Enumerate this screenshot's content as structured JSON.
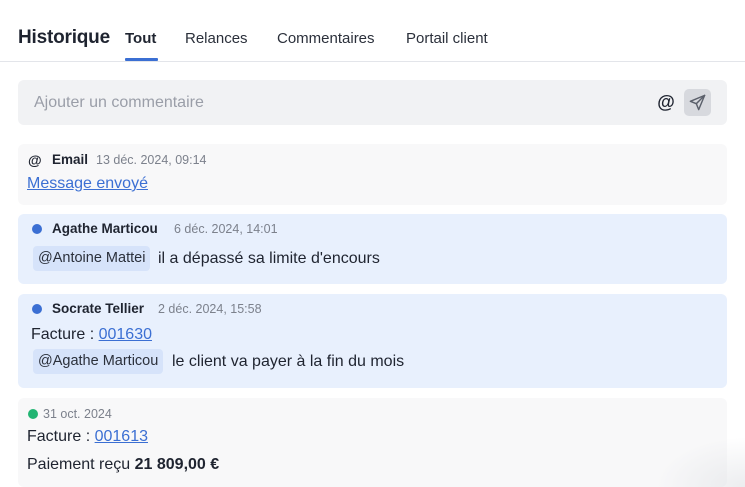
{
  "header": {
    "title": "Historique",
    "tabs": [
      {
        "label": "Tout",
        "active": true
      },
      {
        "label": "Relances",
        "active": false
      },
      {
        "label": "Commentaires",
        "active": false
      },
      {
        "label": "Portail client",
        "active": false
      }
    ]
  },
  "composer": {
    "placeholder": "Ajouter un commentaire",
    "mention_symbol": "@",
    "send_icon": "send-icon"
  },
  "colors": {
    "accent": "#3b6fd3",
    "comment_dot": "#3b6fd3",
    "payment_dot": "#22b573"
  },
  "entries": [
    {
      "type": "email",
      "icon": "@",
      "author": "Email",
      "date": "13 déc. 2024, 09:14",
      "link_text": "Message envoyé"
    },
    {
      "type": "comment",
      "author": "Agathe Marticou",
      "date": "6 déc. 2024, 14:01",
      "mention": "@Antoine Mattei",
      "text": "il a dépassé sa limite d'encours"
    },
    {
      "type": "comment",
      "author": "Socrate Tellier",
      "date": "2 déc. 2024, 15:58",
      "invoice_label": "Facture :",
      "invoice_number": "001630",
      "mention": "@Agathe Marticou",
      "text": "le client va payer à la fin du mois"
    },
    {
      "type": "payment",
      "date": "31 oct. 2024",
      "invoice_label": "Facture :",
      "invoice_number": "001613",
      "payment_label": "Paiement reçu",
      "amount": "21 809,00 €"
    }
  ]
}
